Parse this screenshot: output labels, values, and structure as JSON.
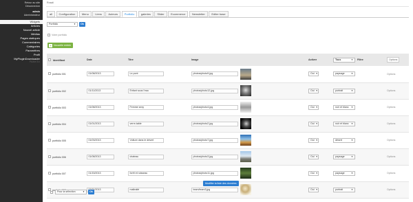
{
  "sidebar": {
    "top_links": [
      "Retour au site",
      "Déconnexion"
    ],
    "user": {
      "name": "admin",
      "role": "Administrateur"
    },
    "items": [
      {
        "label": "Widgets",
        "active": true
      },
      {
        "label": "Articles"
      },
      {
        "label": "Nouvel article"
      },
      {
        "label": "Médias"
      },
      {
        "label": "Pages statiques"
      },
      {
        "label": "Commentaires"
      },
      {
        "label": "Catégories"
      },
      {
        "label": "Paramètres"
      },
      {
        "label": "Profil"
      },
      {
        "label": "MyPluginDownloader"
      }
    ],
    "footer": "PluXml 5.x"
  },
  "breadcrumb": "Rosali",
  "tabs": [
    "all",
    "Configuration",
    "Menu",
    "Liens",
    "Auteurs",
    "Portfolio",
    "galeries",
    "Slider",
    "Ecommerce",
    "Newsletter",
    "Editer base"
  ],
  "active_tab": "Portfolio",
  "top_select": {
    "value": "Portfolio",
    "ok": "Ok"
  },
  "checkbox_label": "Votre portfolio",
  "new_button": "Nouvelle entrée",
  "table": {
    "headers": {
      "id": "Identifiant",
      "date": "Date",
      "title": "Titre",
      "image": "Image",
      "active": "Activer",
      "filter_select": "Tous",
      "filter": "Filtre",
      "options": "Options"
    },
    "rows": [
      {
        "id": "portfolio 001",
        "date": "01/08/2013",
        "title": "Le pont",
        "image": "photos/photo9.jpg",
        "active": "Oui",
        "filter": "paysage",
        "options": "Options",
        "thumb": "bridge"
      },
      {
        "id": "portfolio 002",
        "date": "01/11/2013",
        "title": "Enfant sous l'eau",
        "image": "photos/photo12.jpg",
        "active": "Oui",
        "filter": "portrait",
        "options": "Options",
        "thumb": "bw"
      },
      {
        "id": "portfolio 003",
        "date": "01/08/2013",
        "title": "Femme sexy",
        "image": "photos/photo4.jpg",
        "active": "Oui",
        "filter": "noir et blanc",
        "options": "Options",
        "thumb": "woman"
      },
      {
        "id": "portfolio 004",
        "date": "01/01/2013",
        "title": "verre-table",
        "image": "photos/photo2.jpg",
        "active": "Oui",
        "filter": "noir et blanc",
        "options": "Options",
        "thumb": "glass"
      },
      {
        "id": "portfolio 005",
        "date": "01/03/2013",
        "title": "Voiture dans le désert",
        "image": "photos/photo7.jpg",
        "active": "Oui",
        "filter": "désert",
        "options": "Options",
        "thumb": "desert"
      },
      {
        "id": "portfolio 006",
        "date": "01/08/2013",
        "title": "chateau",
        "image": "photos/photo3.jpg",
        "active": "Oui",
        "filter": "paysage",
        "options": "Options",
        "thumb": "castle"
      },
      {
        "id": "portfolio 007",
        "date": "01/15/2013",
        "title": "forêt et ruisseau",
        "image": "photos/photo11.jpg",
        "active": "Oui",
        "filter": "paysage",
        "options": "Options",
        "thumb": "forest"
      },
      {
        "id": "portfolio 008",
        "date": "02/21/2013",
        "title": "maltraité",
        "image": "team/team3.jpg",
        "active": "Oui",
        "filter": "portrait",
        "options": "Options",
        "thumb": "portrait"
      }
    ]
  },
  "save_button": "Modifier la liste des données",
  "bottom_select": {
    "value": "Pour la sélection",
    "ok": "Ok"
  },
  "colors": {
    "sidebar_bg": "#2b2b2b",
    "accent": "#2c7dd1",
    "new_btn": "#7cb342"
  }
}
